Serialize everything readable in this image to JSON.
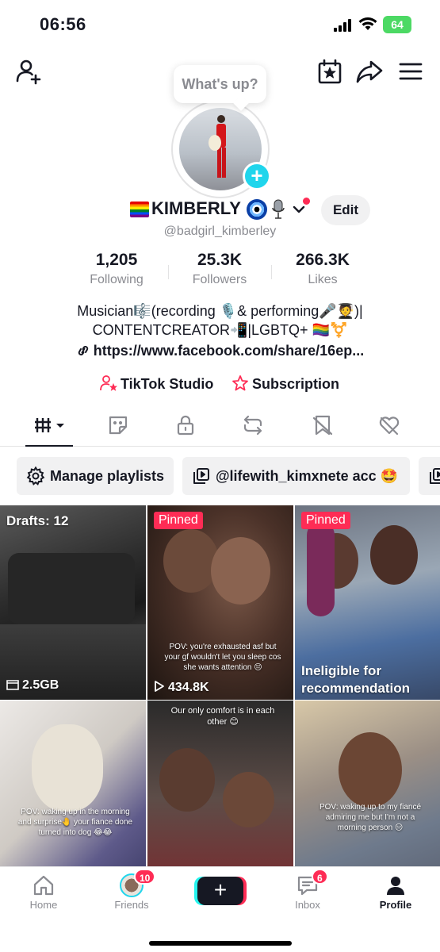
{
  "status_bar": {
    "time": "06:56",
    "battery": "64"
  },
  "bubble": {
    "text": "What's up?"
  },
  "profile": {
    "name": "KIMBERLY",
    "handle": "@badgirl_kimberley",
    "edit_label": "Edit",
    "stats": [
      {
        "value": "1,205",
        "label": "Following"
      },
      {
        "value": "25.3K",
        "label": "Followers"
      },
      {
        "value": "266.3K",
        "label": "Likes"
      }
    ],
    "bio_line1": "Musician🎼(recording 🎙️& performing🎤🧑‍🎓)|",
    "bio_line2": "CONTENTCREATOR📲|LGBTQ+ 🏳️‍🌈⚧️",
    "link": "https://www.facebook.com/share/16ep..."
  },
  "tools": {
    "studio": "TikTok Studio",
    "subscription": "Subscription"
  },
  "chips": {
    "manage": "Manage playlists",
    "account": "@lifewith_kimxnete acc 🤩"
  },
  "grid": [
    {
      "top_label": "Drafts: 12",
      "bottom_label": "2.5GB"
    },
    {
      "pinned": "Pinned",
      "caption": "POV: you're exhausted asf but your gf wouldn't let you sleep cos she wants attention 😔",
      "views": "434.8K"
    },
    {
      "pinned": "Pinned",
      "bottom_label": "Ineligible for recommendation"
    },
    {
      "caption": "POV: waking up in the morning and surprise🤚 your fiance done turned into dog 😂😂"
    },
    {
      "caption": "Our only comfort is in each other 😊"
    },
    {
      "caption": "POV: waking up to my fiancé admiring me but I'm not a morning person 😑"
    }
  ],
  "bottom_nav": {
    "home": "Home",
    "friends": "Friends",
    "friends_badge": "10",
    "plus": "+",
    "inbox": "Inbox",
    "inbox_badge": "6",
    "profile": "Profile"
  },
  "colors": {
    "accent_red": "#fe2c55",
    "accent_cyan": "#20d5ec",
    "text": "#161823",
    "muted": "#8a8b91"
  }
}
